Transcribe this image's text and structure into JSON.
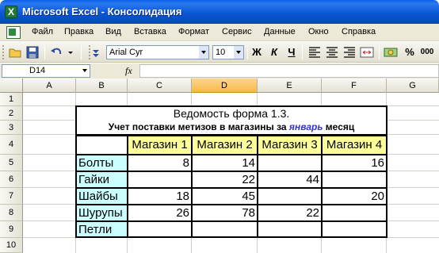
{
  "window": {
    "title": "Microsoft Excel - Консолидация"
  },
  "menu": [
    "Файл",
    "Правка",
    "Вид",
    "Вставка",
    "Формат",
    "Сервис",
    "Данные",
    "Окно",
    "Справка"
  ],
  "toolbar": {
    "font_name": "Arial Cyr",
    "font_size": "10",
    "bold": "Ж",
    "italic": "К",
    "underline": "Ч",
    "percent": "%",
    "thousands": "000"
  },
  "formula_bar": {
    "name_box": "D14",
    "fx": "fx",
    "content": ""
  },
  "columns": [
    "A",
    "B",
    "C",
    "D",
    "E",
    "F",
    "G"
  ],
  "rows": [
    "1",
    "2",
    "3",
    "4",
    "5",
    "6",
    "7",
    "8",
    "9",
    "10"
  ],
  "sheet": {
    "title": "Ведомость форма 1.3.",
    "subtitle_pre": "Учет поставки метизов в магазины за ",
    "subtitle_month": "январь",
    "subtitle_post": " месяц",
    "headers": [
      "Магазин 1",
      "Магазин 2",
      "Магазин 3",
      "Магазин 4"
    ],
    "items": [
      {
        "name": "Болты",
        "values": [
          "8",
          "14",
          "",
          "16"
        ]
      },
      {
        "name": "Гайки",
        "values": [
          "",
          "22",
          "44",
          ""
        ]
      },
      {
        "name": "Шайбы",
        "values": [
          "18",
          "45",
          "",
          "20"
        ]
      },
      {
        "name": "Шурупы",
        "values": [
          "26",
          "78",
          "22",
          ""
        ]
      },
      {
        "name": "Петли",
        "values": [
          "",
          "",
          "",
          ""
        ]
      }
    ]
  },
  "colors": {
    "title_bar": "#0a56d6",
    "header_fill": "#ffff99",
    "item_fill": "#ccffff",
    "month_text": "#3333cc",
    "active_header": "#f6b94a"
  }
}
